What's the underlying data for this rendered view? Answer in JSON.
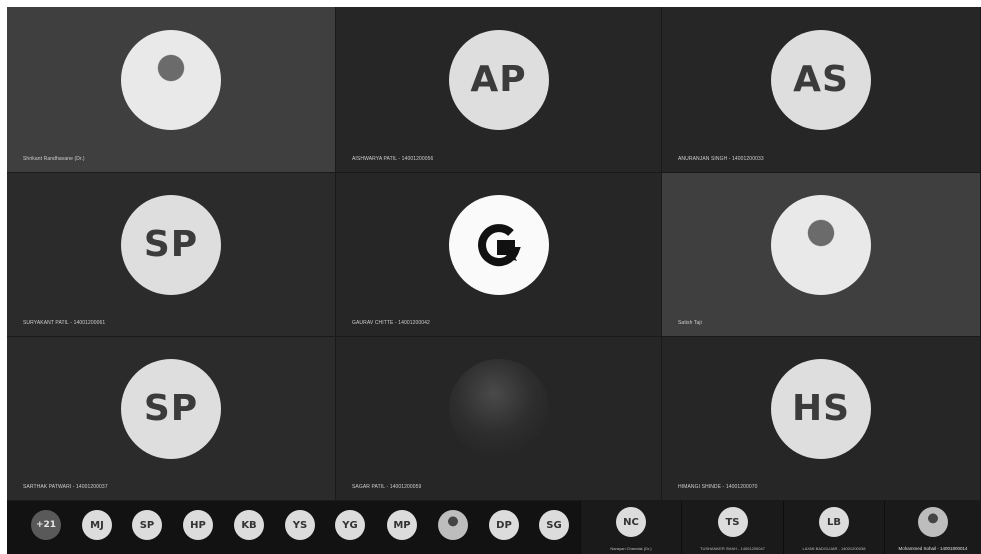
{
  "tiles": [
    {
      "name": "Shrikant Randhavane (Dr.)",
      "initials": "",
      "avatar": "photo"
    },
    {
      "name": "AISHWARYA PATIL - 14001200056",
      "initials": "AP",
      "avatar": "initials"
    },
    {
      "name": "ANURANJAN SINGH - 14001200033",
      "initials": "AS",
      "avatar": "initials"
    },
    {
      "name": "SURYAKANT PATIL - 14001200061",
      "initials": "SP",
      "avatar": "initials"
    },
    {
      "name": "GAURAV CHITTE - 14001200042",
      "initials": "",
      "avatar": "logo"
    },
    {
      "name": "Satish Taji",
      "initials": "",
      "avatar": "photo"
    },
    {
      "name": "SARTHAK PATWARI - 14001200037",
      "initials": "SP",
      "avatar": "initials"
    },
    {
      "name": "SAGAR PATIL - 14001200059",
      "initials": "",
      "avatar": "dark-photo"
    },
    {
      "name": "HIMANGI SHINDE - 14001200070",
      "initials": "HS",
      "avatar": "initials"
    }
  ],
  "strip": {
    "overflow_count": "+21",
    "chips": [
      "MJ",
      "SP",
      "HP",
      "KB",
      "YS",
      "YG",
      "MP",
      "",
      "DP",
      "SG"
    ],
    "named": [
      {
        "initials": "NC",
        "name": "Narayan Chandak (Dr.)"
      },
      {
        "initials": "TS",
        "name": "TUSHANKER SHAH - 14001200047"
      },
      {
        "initials": "LB",
        "name": "LAXMI BADGUJAR - 14001200038"
      },
      {
        "initials": "",
        "name": "Mohammed Sohail - 14001800014"
      }
    ]
  }
}
